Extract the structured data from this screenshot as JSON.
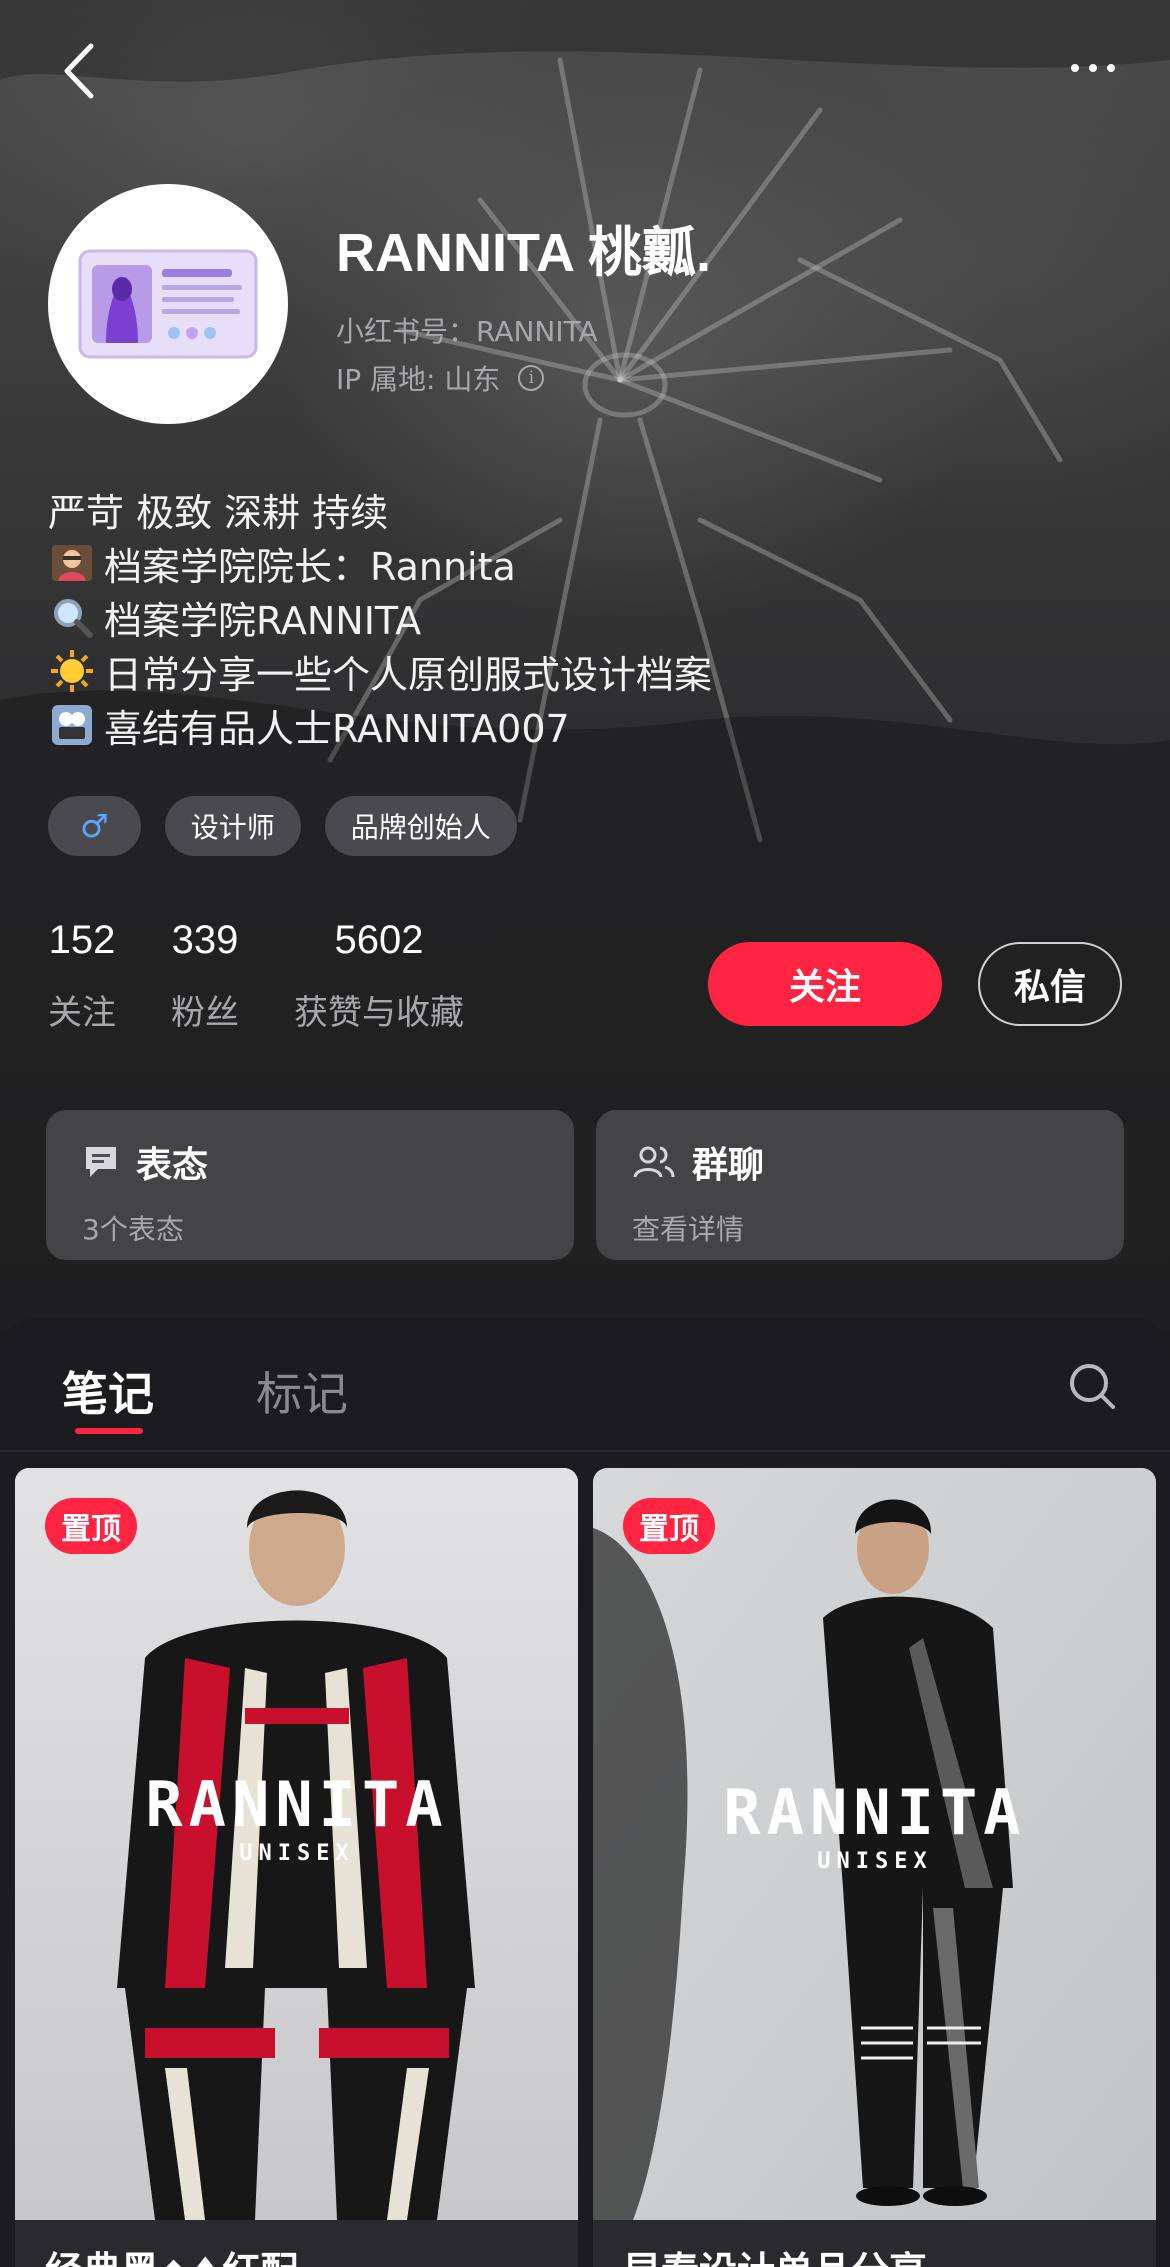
{
  "profile": {
    "name": "RANNITA 桃瓤.",
    "red_id": "小红书号：RANNITA",
    "ip_location": "IP 属地: 山东",
    "bio": [
      {
        "icon": "teacher-emoji-icon",
        "text": "严苛 极致 深耕 持续"
      },
      {
        "icon": "teacher-emoji-icon",
        "text": "档案学院院长：Rannita"
      },
      {
        "icon": "magnifier-emoji-icon",
        "text": "档案学院RANNITA"
      },
      {
        "icon": "sun-emoji-icon",
        "text": "日常分享一些个人原创服式设计档案"
      },
      {
        "icon": "camera-emoji-icon",
        "text": "喜结有品人士RANNITA007"
      }
    ],
    "tags": [
      "♂",
      "设计师",
      "品牌创始人"
    ]
  },
  "stats": [
    {
      "value": "152",
      "label": "关注"
    },
    {
      "value": "339",
      "label": "粉丝"
    },
    {
      "value": "5602",
      "label": "获赞与收藏"
    }
  ],
  "actions": {
    "follow": "关注",
    "message": "私信"
  },
  "cards": [
    {
      "title": "表态",
      "sub": "3个表态",
      "icon": "comment-icon"
    },
    {
      "title": "群聊",
      "sub": "查看详情",
      "icon": "group-icon"
    }
  ],
  "tabs": {
    "notes": "笔记",
    "marked": "标记"
  },
  "notes": [
    {
      "badge": "置顶",
      "title": "经典黑◆♦红配",
      "brand": "RANNITA",
      "brand_sub": "UNISEX"
    },
    {
      "badge": "置顶",
      "title": "早春设计单品分享",
      "brand": "RANNITA",
      "brand_sub": "UNISEX"
    }
  ],
  "colors": {
    "accent": "#ff2442",
    "background": "#1c1c1e",
    "muted": "#a8a8ac"
  }
}
